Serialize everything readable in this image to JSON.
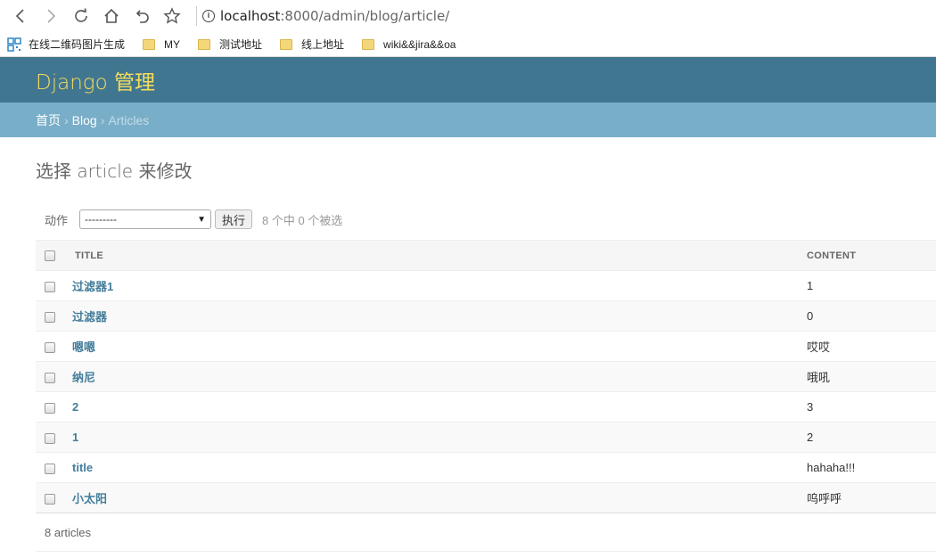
{
  "browser": {
    "url_host": "localhost",
    "url_path": ":8000/admin/blog/article/",
    "bookmarks": [
      {
        "label": "在线二维码图片生成"
      },
      {
        "label": "MY"
      },
      {
        "label": "测试地址"
      },
      {
        "label": "线上地址"
      },
      {
        "label": "wiki&&jira&&oa"
      }
    ]
  },
  "header": {
    "brand": "Django 管理"
  },
  "breadcrumbs": {
    "home": "首页",
    "app": "Blog",
    "current": "Articles",
    "separator": "›"
  },
  "page_title": "选择 article 来修改",
  "actions": {
    "label": "动作",
    "selected": "---------",
    "go_label": "执行",
    "counter": "8 个中 0 个被选"
  },
  "table": {
    "columns": [
      "TITLE",
      "CONTENT"
    ],
    "rows": [
      {
        "title": "过滤器1",
        "content": "1"
      },
      {
        "title": "过滤器",
        "content": "0"
      },
      {
        "title": "嗯嗯",
        "content": "哎哎"
      },
      {
        "title": "纳尼",
        "content": "哦吼"
      },
      {
        "title": "2",
        "content": "3"
      },
      {
        "title": "1",
        "content": "2"
      },
      {
        "title": "title",
        "content": "hahaha!!!"
      },
      {
        "title": "小太阳",
        "content": "呜呼呼"
      }
    ]
  },
  "paginator": "8 articles",
  "colors": {
    "header_bg": "#417690",
    "brand": "#f5dd5d",
    "breadcrumbs_bg": "#79aec8",
    "link": "#447e9b"
  }
}
